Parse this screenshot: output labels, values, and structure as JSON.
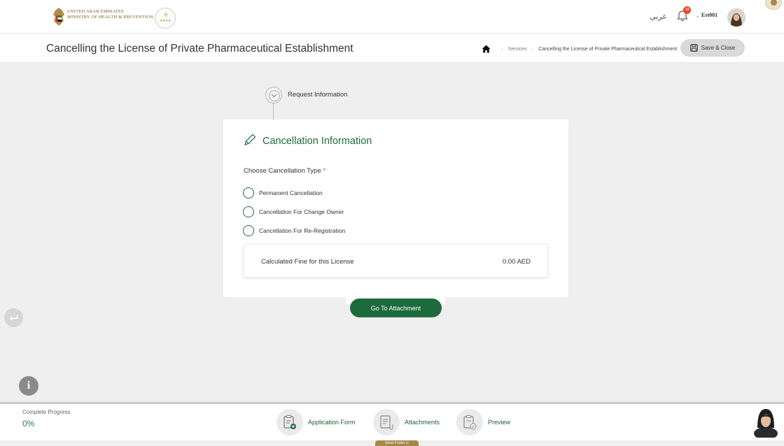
{
  "header": {
    "ministry_line1": "UNITED ARAB EMIRATES",
    "ministry_line2": "MINISTRY OF HEALTH & PREVENTION",
    "language": "عربي",
    "notification_count": "18",
    "username": "Est001"
  },
  "titlebar": {
    "title": "Cancelling the License of Private Pharmaceutical Establishment",
    "breadcrumb": {
      "services": "Services",
      "current": "Cancelling the License of Private Pharmaceutical Establishment"
    },
    "save_close": "Save & Close"
  },
  "stepper": {
    "request_info": "Request Information"
  },
  "form": {
    "title": "Cancellation Information",
    "cancellation_type_label": "Choose Cancellation Type",
    "required_marker": "*",
    "options": [
      {
        "label": "Permanent Cancellation",
        "selected": false
      },
      {
        "label": "Cancellation For Change Owner",
        "selected": false
      },
      {
        "label": "Cancellation For Re-Registration",
        "selected": false
      }
    ],
    "fine_label": "Calculated Fine for this License",
    "fine_value": "0.00 AED",
    "go_button": "Go To Attachment"
  },
  "footer": {
    "progress_label": "Complete Progress",
    "progress_value": "0%",
    "steps": [
      {
        "label": "Application Form"
      },
      {
        "label": "Attachments"
      },
      {
        "label": "Preview"
      }
    ],
    "show_footer": "Show Footer"
  },
  "colors": {
    "brand_green": "#1d6b3c",
    "gold": "#a68848",
    "alert": "#e84b2a"
  },
  "icons": {
    "home": "home-icon",
    "save": "floppy-icon",
    "edit": "pencil-icon",
    "bell": "bell-icon",
    "back": "arrow-return-icon",
    "info": "info-icon"
  }
}
